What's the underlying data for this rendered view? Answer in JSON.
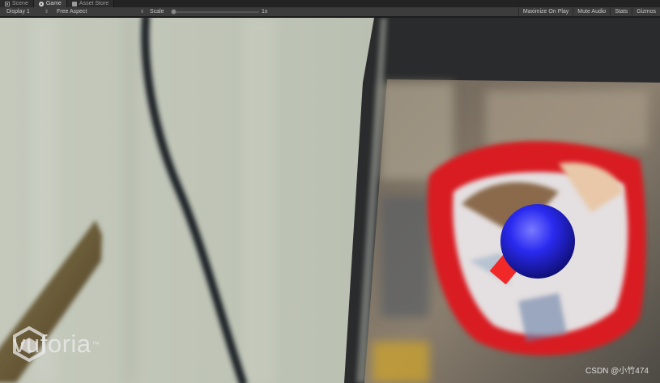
{
  "tabs": [
    {
      "label": "Scene",
      "icon": "scene-icon",
      "active": false
    },
    {
      "label": "Game",
      "icon": "game-icon",
      "active": true
    },
    {
      "label": "Asset Store",
      "icon": "asset-store-icon",
      "active": false
    }
  ],
  "toolbar": {
    "display": "Display 1",
    "aspect": "Free Aspect",
    "scale_label": "Scale",
    "scale_value": "1x",
    "scale_fraction": 0.02,
    "maximize_on_play": "Maximize On Play",
    "mute_audio": "Mute Audio",
    "stats": "Stats",
    "gizmos": "Gizmos"
  },
  "game": {
    "watermark": "vuforia",
    "watermark_tm": "™",
    "credit": "CSDN @小竹474",
    "sphere_color": "#2a2af0",
    "cube_color": "#f02828"
  }
}
